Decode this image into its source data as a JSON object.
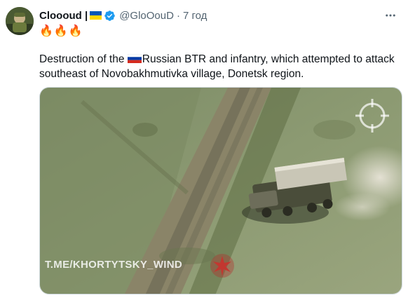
{
  "author": {
    "display_name": "Cloooud |",
    "handle": "@GloOouD",
    "separator": "·",
    "time": "7 год",
    "emoji_line": "🔥🔥🔥"
  },
  "icons": {
    "flag": "ukraine-flag-icon",
    "verified": "verified-badge-icon",
    "more": "more-options-icon",
    "ru_flag": "russia-flag-icon",
    "target": "crosshair-icon",
    "wm_logo": "tryzub-logo-icon"
  },
  "tweet": {
    "text_before_flag": "Destruction of the ",
    "text_after_flag": "Russian BTR and infantry, which attempted to attack southeast of Novobakhmutivka village, Donetsk region."
  },
  "media": {
    "watermark": "T.ME/KHORTYTSKY_WIND"
  },
  "colors": {
    "text": "#0f1419",
    "muted": "#536471",
    "verified": "#1d9bf0",
    "ua_blue": "#0057b7",
    "ua_yellow": "#ffd700"
  }
}
